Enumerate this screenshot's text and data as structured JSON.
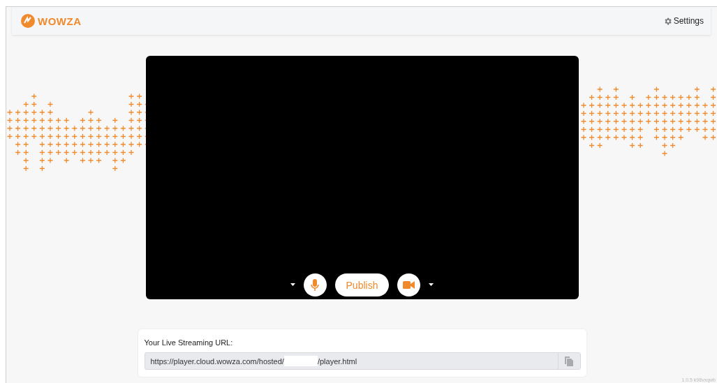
{
  "header": {
    "logo_text": "WOWZA",
    "settings_label": "Settings"
  },
  "controls": {
    "publish_label": "Publish"
  },
  "url_card": {
    "label": "Your Live Streaming URL:",
    "url_prefix": "https://player.cloud.wowza.com/hosted/",
    "url_suffix": "/player.html"
  },
  "version": "1.0.5 k98vxqwb"
}
